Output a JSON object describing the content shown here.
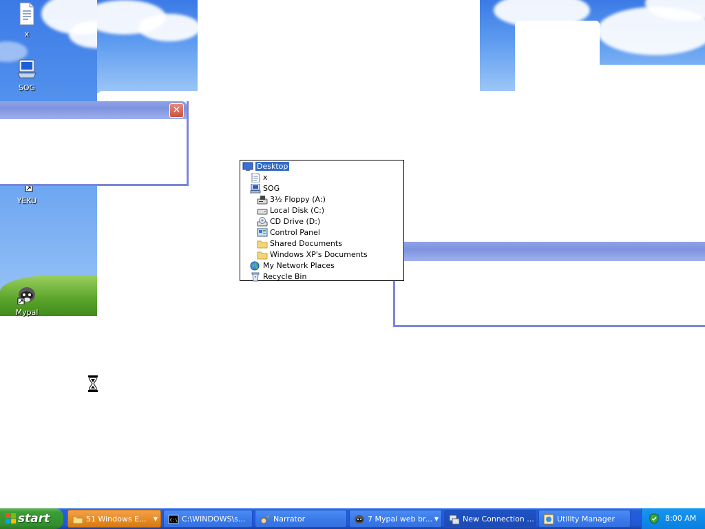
{
  "desktop": {
    "icons": [
      {
        "label": "x",
        "icon": "text-document-icon"
      },
      {
        "label": "SOG",
        "icon": "my-computer-icon"
      },
      {
        "label": "YEKU",
        "icon": "shortcut-icon"
      },
      {
        "label": "Mypal",
        "icon": "mypal-raccoon-icon"
      }
    ]
  },
  "tree_dropdown": {
    "items": [
      {
        "label": "Desktop",
        "icon": "desktop-icon",
        "selected": true
      },
      {
        "label": "x",
        "icon": "text-document-icon"
      },
      {
        "label": "SOG",
        "icon": "my-computer-icon"
      },
      {
        "label": "3½ Floppy (A:)",
        "icon": "floppy-drive-icon"
      },
      {
        "label": "Local Disk (C:)",
        "icon": "hard-disk-icon"
      },
      {
        "label": "CD Drive (D:)",
        "icon": "cd-drive-icon"
      },
      {
        "label": "Control Panel",
        "icon": "control-panel-icon"
      },
      {
        "label": "Shared Documents",
        "icon": "folder-icon"
      },
      {
        "label": "Windows XP's Documents",
        "icon": "folder-icon"
      },
      {
        "label": "My Network Places",
        "icon": "network-places-icon"
      },
      {
        "label": "Recycle Bin",
        "icon": "recycle-bin-icon"
      }
    ]
  },
  "taskbar": {
    "start_label": "start",
    "buttons": [
      {
        "label": "51 Windows E...",
        "icon": "folder-icon",
        "has_dropdown": true,
        "state": "flashing"
      },
      {
        "label": "C:\\WINDOWS\\s...",
        "icon": "command-prompt-icon"
      },
      {
        "label": "Narrator",
        "icon": "narrator-icon"
      },
      {
        "label": "7 Mypal web br...",
        "icon": "mypal-raccoon-icon",
        "has_dropdown": true
      },
      {
        "label": "New Connection ...",
        "icon": "network-connection-icon",
        "state": "active"
      },
      {
        "label": "Utility Manager",
        "icon": "utility-manager-icon"
      }
    ],
    "tray": {
      "clock": "8:00 AM",
      "icon": "security-shield-icon"
    }
  },
  "colors": {
    "taskbar_blue": "#245edb",
    "start_green": "#3c9d35",
    "selection_blue": "#316ac5",
    "flashing_orange": "#e58a22",
    "tray_blue": "#0f8bea"
  }
}
